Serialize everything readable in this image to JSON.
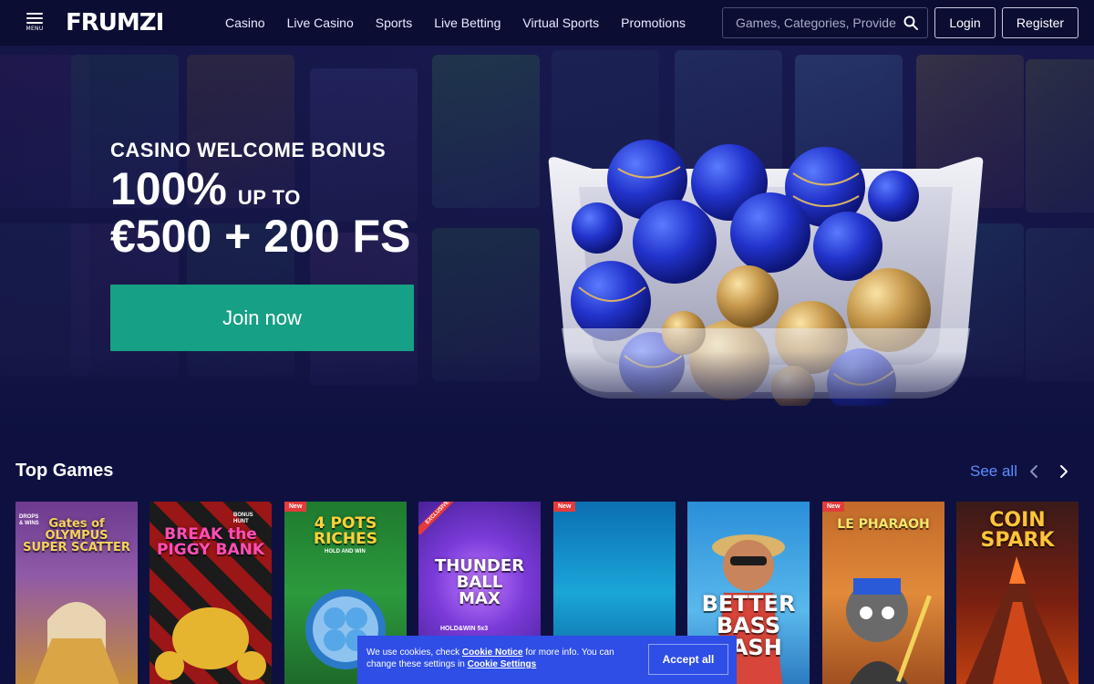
{
  "header": {
    "menu_label": "MENU",
    "logo_text": "FRUMZI",
    "nav": [
      "Casino",
      "Live Casino",
      "Sports",
      "Live Betting",
      "Virtual Sports",
      "Promotions"
    ],
    "search_placeholder": "Games, Categories, Providers",
    "login_label": "Login",
    "register_label": "Register"
  },
  "hero": {
    "kicker": "CASINO WELCOME BONUS",
    "percent": "100%",
    "upto": "UP TO",
    "amount": "€500 + 200 FS",
    "cta_label": "Join now"
  },
  "top_games": {
    "title": "Top Games",
    "see_all": "See all",
    "games": [
      {
        "title": "Gates of\nOLYMPUS\nSUPER SCATTER",
        "badge": "",
        "extra": "DROPS\n& WINS"
      },
      {
        "title": "BREAK the\nPIGGY BANK",
        "badge": "",
        "extra": "BONUS HUNT"
      },
      {
        "title": "4 POTS\nRICHES",
        "badge": "New",
        "extra": "HOLD AND WIN"
      },
      {
        "title": "THUNDER\nBALL\nMAX",
        "badge": "EXCLUSIVE",
        "extra": "HOLD&WIN 5x3"
      },
      {
        "title": "",
        "badge": "New",
        "extra": ""
      },
      {
        "title": "BETTER\nBASS\nCASH",
        "badge": "",
        "extra": ""
      },
      {
        "title": "LE PHARAOH",
        "badge": "New",
        "extra": ""
      },
      {
        "title": "COIN\nSPARK",
        "badge": "",
        "extra": ""
      }
    ]
  },
  "cookie": {
    "text_1": "We use cookies, check ",
    "link_1": "Cookie Notice",
    "text_2": " for more info. You can change these settings in ",
    "link_2": "Cookie Settings",
    "accept_label": "Accept all"
  },
  "colors": {
    "background": "#0e1140",
    "header": "#0b0d33",
    "accent_green": "#16a085",
    "link_blue": "#5f8dff",
    "cookie_blue": "#2f4ee6",
    "logo_blue": "#4c67ff"
  }
}
